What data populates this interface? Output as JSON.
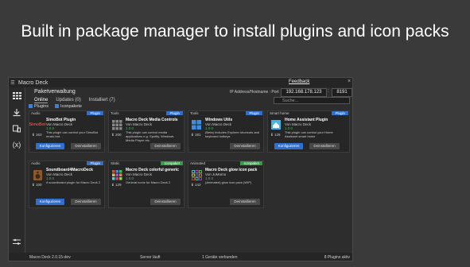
{
  "caption": "Built in package manager to install plugins and icon packs",
  "window": {
    "title": "Macro Deck",
    "feedback": "Feedback",
    "close": "×"
  },
  "sidebar": {
    "icons": [
      "grid-icon",
      "download-icon",
      "devices-icon",
      "variables-icon",
      "settings-icon"
    ],
    "variables_label": "(x)"
  },
  "package_manager": {
    "title": "Paketverwaltung",
    "tabs": [
      {
        "label": "Online"
      },
      {
        "label": "Updates (0)"
      },
      {
        "label": "Installiert (7)"
      }
    ],
    "filters": {
      "plugins": "Plugins",
      "iconpacks": "Iconpakete"
    },
    "ip_label": "IP Address/Hostname : Port",
    "ip_value": "192.168.178.123",
    "port_value": "8191",
    "search_placeholder": "Suche..."
  },
  "buttons": {
    "configure": "Konfigurieren",
    "uninstall": "Deinstallieren"
  },
  "cards": [
    {
      "category": "Audio",
      "badge": "Plugin",
      "badge_color": "#2e6fd0",
      "name": "SimoBot Plugin",
      "author": "Von Macro Deck",
      "version": "1.0.0",
      "desc": "This plugin can control your SimoBot music bot.",
      "downloads": "163",
      "icon": "simobot-icon",
      "icon_label": "SimoBot",
      "has_config": true
    },
    {
      "category": "Tools",
      "badge": "Plugin",
      "badge_color": "#2e6fd0",
      "name": "Macro Deck Media Controls",
      "author": "Von Macro Deck",
      "version": "1.0.0",
      "desc": "This plugin can control media applications e.g. Spotify, Windows Media Player etc.",
      "downloads": "200",
      "icon": "media-grid-icon",
      "icon_label": "",
      "has_config": false
    },
    {
      "category": "Tools",
      "badge": "Plugin",
      "badge_color": "#2e6fd0",
      "name": "Windows Utils",
      "author": "Von Macro Deck",
      "version": "1.0.0",
      "desc": "(Beta) Includes Explorer shortcuts and keyboard hotkeys",
      "downloads": "181",
      "icon": "windows-icon",
      "icon_label": "",
      "has_config": false
    },
    {
      "category": "Smart home",
      "badge": "Plugin",
      "badge_color": "#2e6fd0",
      "name": "Home Assistant Plugin",
      "author": "Von Macro Deck",
      "version": "1.0.0",
      "desc": "This plugin can control your Home Assistant smart home",
      "downloads": "126",
      "icon": "home-icon",
      "icon_label": "",
      "has_config": true
    },
    {
      "category": "Audio",
      "badge": "Plugin",
      "badge_color": "#2e6fd0",
      "name": "Soundboard4MacroDeck",
      "author": "Von Macro Deck",
      "version": "1.0.0",
      "desc": "A soundboard plugin for Macro Deck 2",
      "downloads": "100",
      "icon": "speaker-icon",
      "icon_label": "",
      "has_config": true
    },
    {
      "category": "Static",
      "badge": "Iconpaket",
      "badge_color": "#2ea043",
      "name": "Macro Deck colorful generic",
      "author": "Von Macro Deck",
      "version": "1.0.0",
      "desc": "General icons for Macro Deck 2",
      "downloads": "129",
      "icon": "icon-grid-icon",
      "icon_label": "",
      "has_config": false
    },
    {
      "category": "Animated",
      "badge": "Iconpaket",
      "badge_color": "#2ea043",
      "name": "Macro Deck glow icon pack",
      "author": "Von JoMomo",
      "version": "1.0.0",
      "desc": "(Animated) glow icon pack (WIP)",
      "downloads": "142",
      "icon": "glow-grid-icon",
      "icon_label": "",
      "has_config": false
    }
  ],
  "status": {
    "version": "Macro Deck 2.0.15-dev",
    "server": "Server läuft",
    "connected": "1 Geräte verbunden",
    "plugins": "8 Plugins aktiv"
  }
}
